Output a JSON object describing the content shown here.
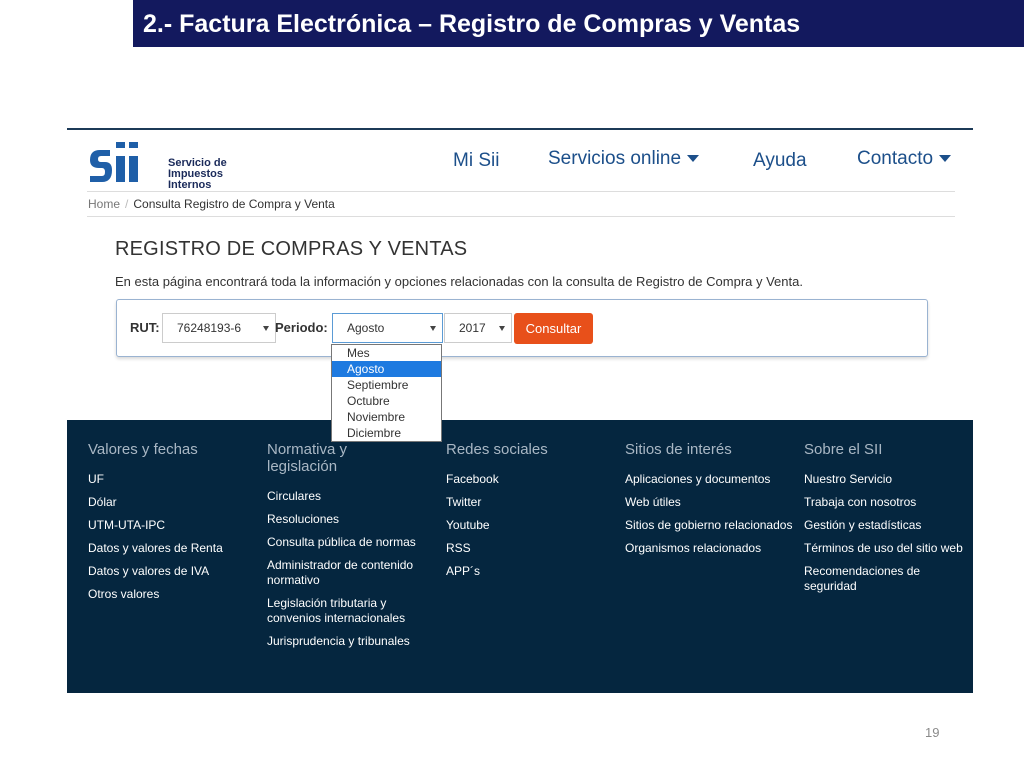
{
  "slide": {
    "title": "2.- Factura Electrónica – Registro de Compras y Ventas",
    "page_number": "19"
  },
  "header": {
    "logo": {
      "mark": "SII",
      "line1": "Servicio de",
      "line2": "Impuestos",
      "line3": "Internos"
    },
    "nav": [
      {
        "label": "Mi Sii",
        "dropdown": false
      },
      {
        "label": "Servicios online",
        "dropdown": true
      },
      {
        "label": "Ayuda",
        "dropdown": false
      },
      {
        "label": "Contacto",
        "dropdown": true
      }
    ]
  },
  "breadcrumb": {
    "home": "Home",
    "separator": "/",
    "current": "Consulta Registro de Compra y Venta"
  },
  "main": {
    "heading": "REGISTRO DE COMPRAS Y VENTAS",
    "intro": "En esta página encontrará toda la información y opciones relacionadas con la consulta de Registro de Compra y Venta."
  },
  "form": {
    "rut_label": "RUT:",
    "rut_value": "76248193-6",
    "periodo_label": "Periodo:",
    "month_value": "Agosto",
    "year_value": "2017",
    "submit_label": "Consultar",
    "month_options": [
      "Mes",
      "Agosto",
      "Septiembre",
      "Octubre",
      "Noviembre",
      "Diciembre"
    ],
    "selected_index": 1
  },
  "footer": {
    "columns": [
      {
        "heading": "Valores y fechas",
        "links": [
          "UF",
          "Dólar",
          "UTM-UTA-IPC",
          "Datos y valores de Renta",
          "Datos y valores de IVA",
          "Otros valores"
        ]
      },
      {
        "heading": "Normativa y legislación",
        "links": [
          "Circulares",
          "Resoluciones",
          "Consulta pública de normas",
          "Administrador de contenido normativo",
          "Legislación tributaria y convenios internacionales",
          "Jurisprudencia y tribunales"
        ]
      },
      {
        "heading": "Redes sociales",
        "links": [
          "Facebook",
          "Twitter",
          "Youtube",
          "RSS",
          "APP´s"
        ]
      },
      {
        "heading": "Sitios de interés",
        "links": [
          "Aplicaciones y documentos",
          "Web útiles",
          "Sitios de gobierno relacionados",
          "Organismos relacionados"
        ]
      },
      {
        "heading": "Sobre el SII",
        "links": [
          "Nuestro Servicio",
          "Trabaja con nosotros",
          "Gestión y estadísticas",
          "Términos de uso del sitio web",
          "Recomendaciones de seguridad"
        ]
      }
    ]
  },
  "colors": {
    "title_bar": "#13195e",
    "nav_link": "#1c4f8a",
    "footer_bg": "#05263f",
    "button": "#e8501a",
    "selected_option": "#1e7ae0"
  }
}
